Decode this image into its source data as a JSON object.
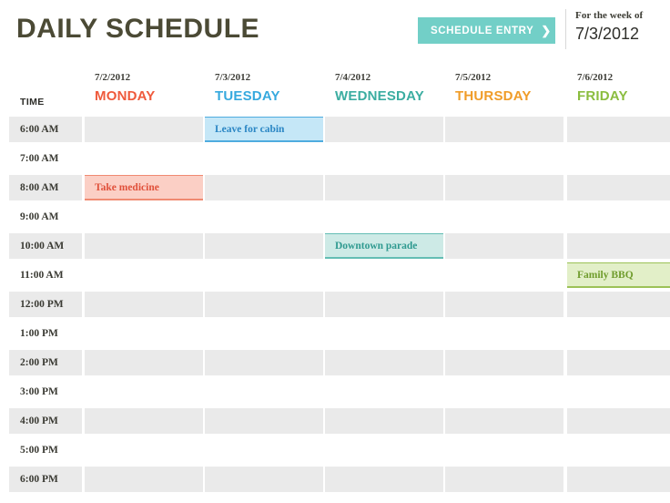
{
  "header": {
    "title": "DAILY SCHEDULE",
    "entry_button": {
      "label": "SCHEDULE ENTRY",
      "chevron": "❯",
      "color": "#72cfc7"
    },
    "week_label": "For the week of",
    "week_date": "7/3/2012"
  },
  "grid": {
    "time_header": "TIME",
    "columns": [
      {
        "date": "7/2/2012",
        "day": "MONDAY",
        "color": "#ef5a3c"
      },
      {
        "date": "7/3/2012",
        "day": "TUESDAY",
        "color": "#36a9de"
      },
      {
        "date": "7/4/2012",
        "day": "WEDNESDAY",
        "color": "#3bada1"
      },
      {
        "date": "7/5/2012",
        "day": "THURSDAY",
        "color": "#f09c28"
      },
      {
        "date": "7/6/2012",
        "day": "FRIDAY",
        "color": "#8bbd3f"
      }
    ],
    "times": [
      "6:00 AM",
      "7:00 AM",
      "8:00 AM",
      "9:00 AM",
      "10:00 AM",
      "11:00 AM",
      "12:00 PM",
      "1:00 PM",
      "2:00 PM",
      "3:00 PM",
      "4:00 PM",
      "5:00 PM",
      "6:00 PM"
    ],
    "cell_color": "#eaeaea",
    "row_shaded": [
      true,
      false,
      true,
      false,
      true,
      false,
      true,
      false,
      true,
      false,
      true,
      false,
      true
    ]
  },
  "events": [
    {
      "title": "Leave for cabin",
      "day": "TUESDAY",
      "day_index": 1,
      "time": "6:00 AM",
      "row_index": 0,
      "text_color": "#2a86c4",
      "bg_color": "#c5e7f7",
      "border_color": "#4facdf"
    },
    {
      "title": "Take medicine",
      "day": "MONDAY",
      "day_index": 0,
      "time": "8:00 AM",
      "row_index": 2,
      "text_color": "#e0503a",
      "bg_color": "#fbcfc5",
      "border_color": "#f08a72"
    },
    {
      "title": "Downtown parade",
      "day": "WEDNESDAY",
      "day_index": 2,
      "time": "10:00 AM",
      "row_index": 4,
      "text_color": "#2f9a90",
      "bg_color": "#cdeae6",
      "border_color": "#63bdb4"
    },
    {
      "title": "Family BBQ",
      "day": "FRIDAY",
      "day_index": 4,
      "time": "11:00 AM",
      "row_index": 5,
      "text_color": "#6f9c2c",
      "bg_color": "#e2efc8",
      "border_color": "#9cc257"
    }
  ]
}
